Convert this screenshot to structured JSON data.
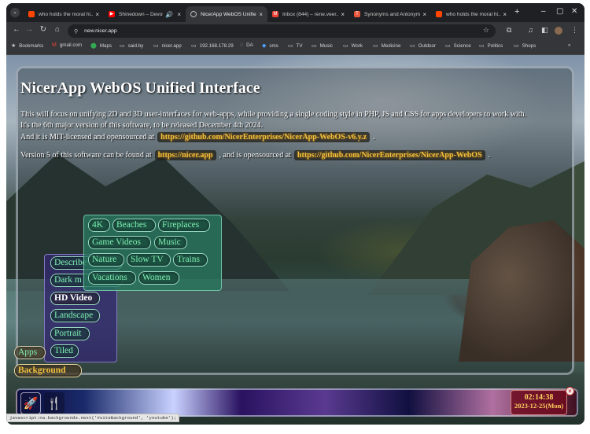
{
  "browser": {
    "tabs": [
      {
        "title": "who holds the moral hi...",
        "icon": "reddit-icon",
        "color": "#ff4500"
      },
      {
        "title": "Shinedown – Devour",
        "icon": "youtube-icon",
        "color": "#ff0000"
      },
      {
        "title": "NicerApp WebOS Unifie...",
        "icon": "globe-icon",
        "color": "#8ab4f8"
      },
      {
        "title": "Inbox (844) – rene.veer...",
        "icon": "gmail-icon",
        "color": "#ea4335"
      },
      {
        "title": "Synonyms and Antonym...",
        "icon": "thesaurus-icon",
        "color": "#e8543c"
      },
      {
        "title": "who holds the moral hi...",
        "icon": "reddit-icon",
        "color": "#ff4500"
      }
    ],
    "active_tab": 2,
    "url": "new.nicer.app",
    "bookmarks": [
      "Bookmarks",
      "gmail.com",
      "Maps",
      "said.by",
      "nicer.app",
      "192.168.178.29",
      "DA",
      "sms",
      "TV",
      "Music",
      "Work",
      "Medicine",
      "Outdoor",
      "Science",
      "Politics",
      "Shops"
    ]
  },
  "page": {
    "title": "NicerApp WebOS Unified Interface",
    "line1": "This will focus on unifying 2D and 3D user-interfaces for web-apps, while providing a single coding style in PHP, JS and CSS for apps developers to work with.",
    "line2": "It's the 6th major version of this software, to be released December 4th 2024.",
    "line3_pre": "And it is MIT-licensed and opensourced at",
    "line3_link": "https://github.com/NicerEnterprises/NicerApp-WebOS-v6.y.z",
    "line3_post": ".",
    "line4_pre": "Version 5 of this software can be found at",
    "line4_link1": "https://nicer.app",
    "line4_mid": ", and is opensourced at",
    "line4_link2": "https://github.com/NicerEnterprises/NicerApp-WebOS",
    "line4_post": "."
  },
  "menus": {
    "categories": [
      "4K",
      "Beaches",
      "Fireplaces",
      "Game Videos",
      "Music",
      "Nature",
      "Slow TV",
      "Trains",
      "Vacations",
      "Women"
    ],
    "submenu": [
      "Describe",
      "Dark m",
      "HD Video",
      "Landscape",
      "Portrait",
      "Tiled"
    ],
    "root": [
      "Apps",
      "Background"
    ]
  },
  "clock": {
    "time": "02:14:38",
    "date": "2023-12-25(Mon)"
  },
  "status_text": "javascript:na.backgrounds.next('#siteBackground', 'youtube');"
}
